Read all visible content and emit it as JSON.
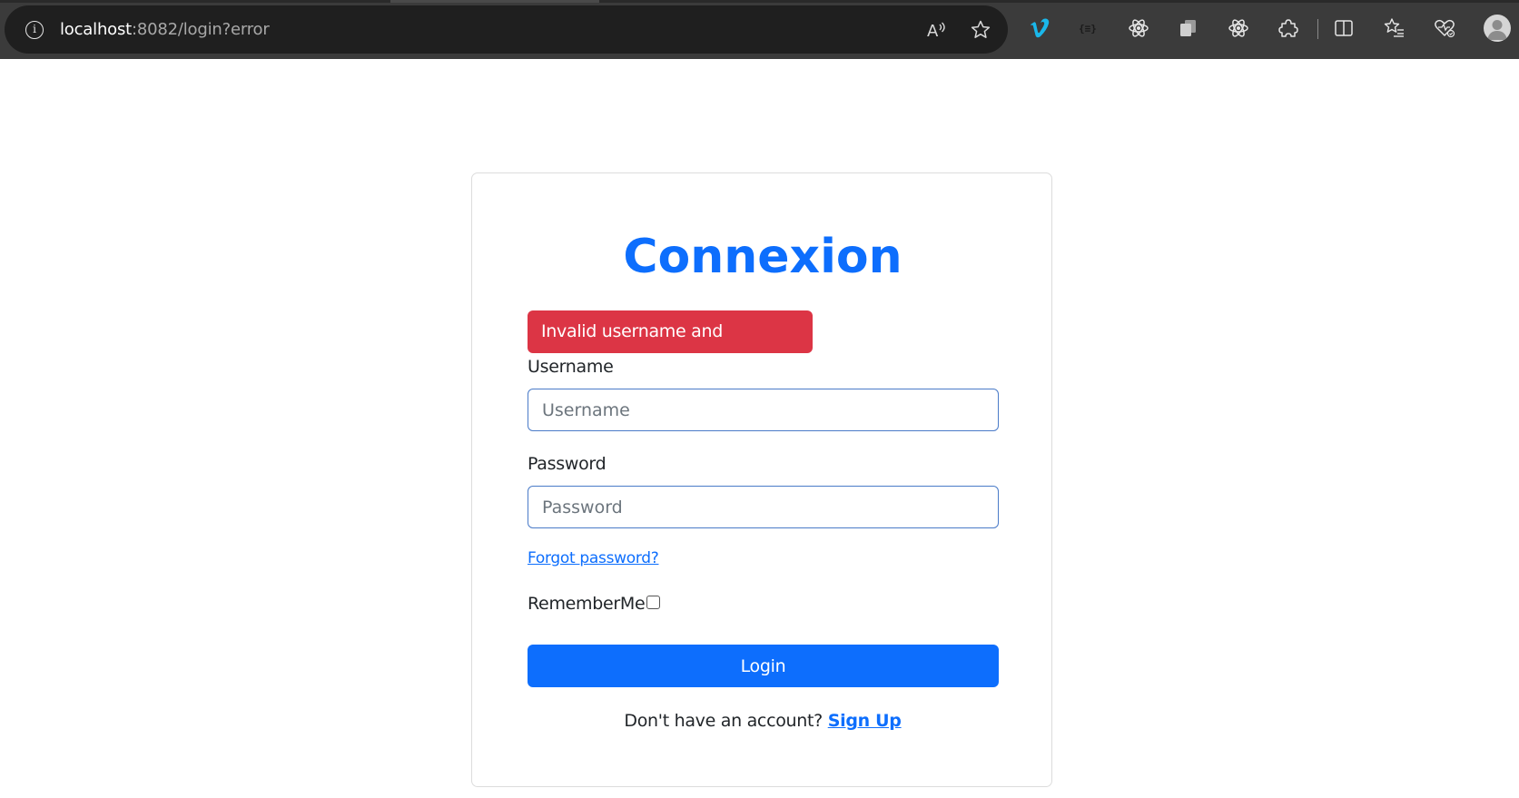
{
  "browser": {
    "url_host": "localhost",
    "url_rest": ":8082/login?error",
    "info_icon": "info-icon",
    "read_aloud_label": "A̩",
    "icons": [
      "read-aloud-icon",
      "favorite-star-icon",
      "vimeo-icon",
      "json-extension-icon",
      "react-devtools-icon",
      "copy-extension-icon",
      "react-icon",
      "extensions-puzzle-icon",
      "split-screen-icon",
      "favorites-icon",
      "browser-health-icon",
      "profile-avatar-icon"
    ]
  },
  "login": {
    "title": "Connexion",
    "error": "Invalid username and password.",
    "username_label": "Username",
    "username_placeholder": "Username",
    "password_label": "Password",
    "password_placeholder": "Password",
    "forgot_link": "Forgot password?",
    "remember_label": "RememberMe",
    "remember_checked": false,
    "login_button": "Login",
    "signup_prompt": "Don't have an account?",
    "signup_link": "Sign Up"
  },
  "colors": {
    "primary": "#0d6efd",
    "danger": "#dc3545",
    "chrome_bg": "#3b3b3b",
    "address_bg": "#1f1f1f"
  }
}
